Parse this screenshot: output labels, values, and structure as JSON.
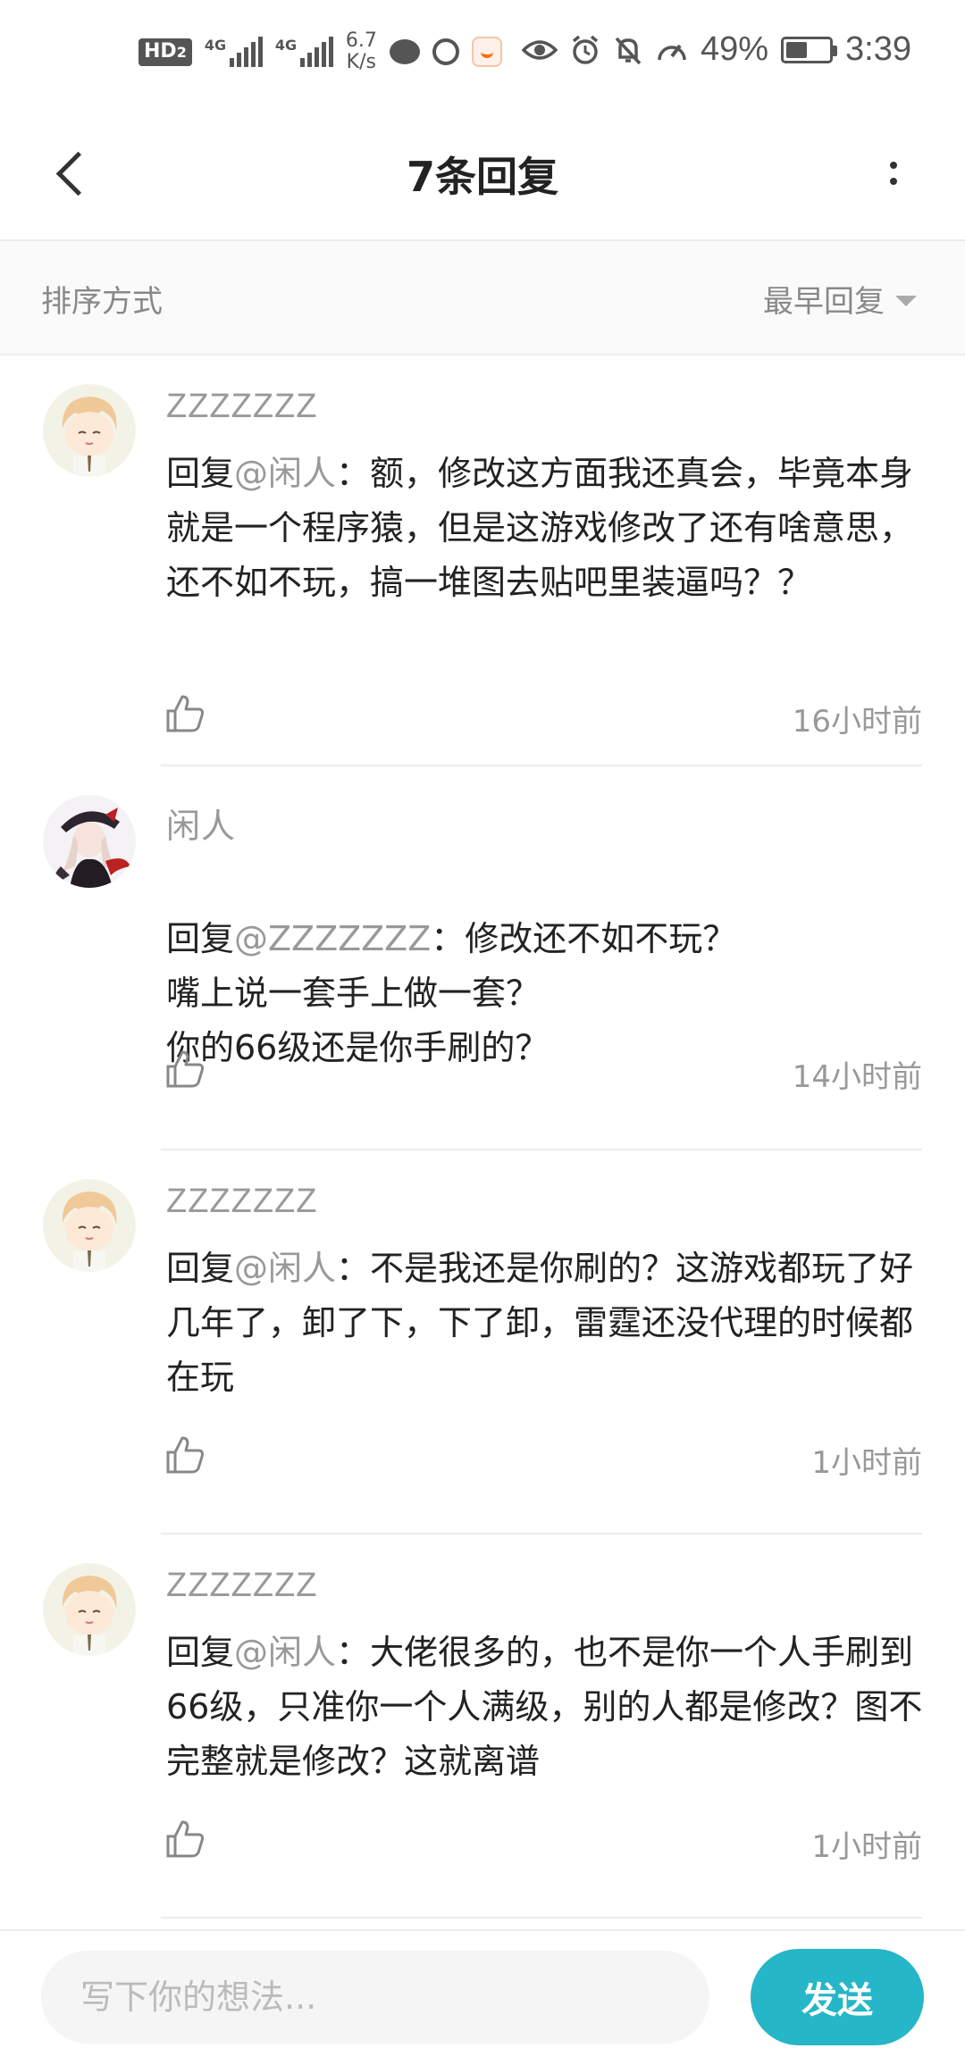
{
  "status_bar": {
    "hd_label": "HD",
    "hd_sub": "2",
    "signal1_label": "4G",
    "signal2_label": "4G",
    "net_speed_value": "6.7",
    "net_speed_unit": "K/s",
    "battery_text": "49%",
    "battery_level": 0.49,
    "time": "3:39"
  },
  "header": {
    "title": "7条回复"
  },
  "sort": {
    "label": "排序方式",
    "selected": "最早回复"
  },
  "replies": [
    {
      "username": "ZZZZZZZ",
      "prefix": "回复",
      "mention": "@闲人",
      "text": "：额，修改这方面我还真会，毕竟本身就是一个程序猿，但是这游戏修改了还有啥意思，还不如不玩，搞一堆图去贴吧里装逼吗？？",
      "time": "16小时前",
      "avatar": "boy-avatar"
    },
    {
      "username": "闲人",
      "prefix": "回复",
      "mention": "@ZZZZZZZ",
      "text": "：修改还不如不玩？\n嘴上说一套手上做一套？\n你的66级还是你手刷的？",
      "time": "14小时前",
      "avatar": "girl-avatar"
    },
    {
      "username": "ZZZZZZZ",
      "prefix": "回复",
      "mention": "@闲人",
      "text": "：不是我还是你刷的？这游戏都玩了好几年了，卸了下，下了卸，雷霆还没代理的时候都在玩",
      "time": "1小时前",
      "avatar": "boy-avatar"
    },
    {
      "username": "ZZZZZZZ",
      "prefix": "回复",
      "mention": "@闲人",
      "text": "：大佬很多的，也不是你一个人手刷到66级，只准你一个人满级，别的人都是修改？图不完整就是修改？这就离谱",
      "time": "1小时前",
      "avatar": "boy-avatar"
    }
  ],
  "composer": {
    "placeholder": "写下你的想法...",
    "send_label": "发送"
  },
  "colors": {
    "accent": "#25b6c8",
    "muted_text": "#999999",
    "divider": "#ececec"
  }
}
